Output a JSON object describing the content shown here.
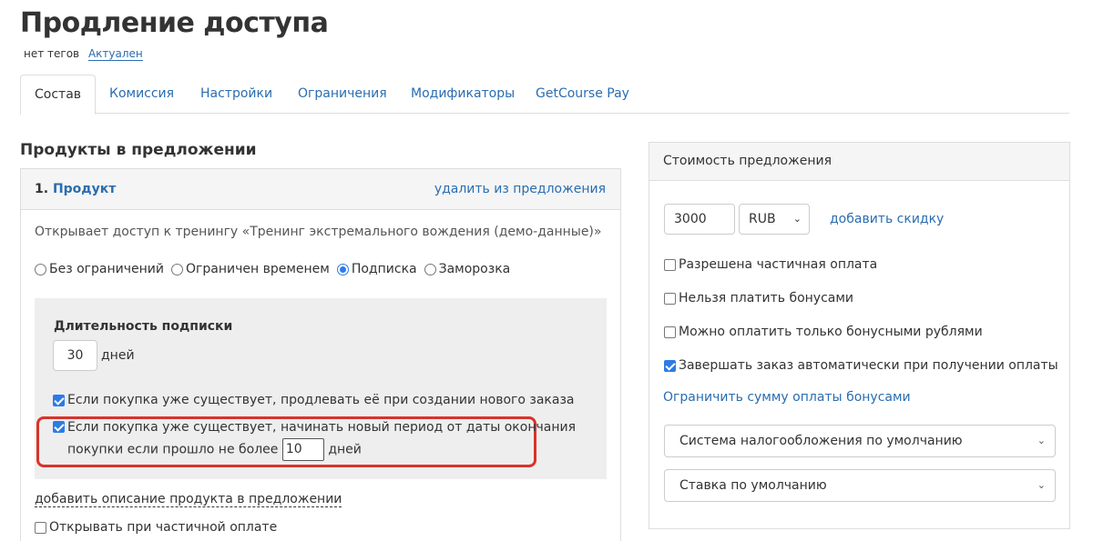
{
  "page": {
    "title": "Продление доступа",
    "tags_label": "нет тегов",
    "status_link": "Актуален"
  },
  "tabs": [
    {
      "label": "Состав",
      "active": true
    },
    {
      "label": "Комиссия"
    },
    {
      "label": "Настройки"
    },
    {
      "label": "Ограничения"
    },
    {
      "label": "Модификаторы"
    },
    {
      "label": "GetCourse Pay"
    }
  ],
  "products": {
    "heading": "Продукты в предложении",
    "item": {
      "number": "1.",
      "name": "Продукт",
      "remove_link": "удалить из предложения",
      "description": "Открывает доступ к тренингу «Тренинг экстремального вождения (демо-данные)»",
      "access_options": [
        {
          "label": "Без ограничений",
          "checked": false
        },
        {
          "label": "Ограничен временем",
          "checked": false
        },
        {
          "label": "Подписка",
          "checked": true
        },
        {
          "label": "Заморозка",
          "checked": false
        }
      ],
      "subscription": {
        "title": "Длительность подписки",
        "duration_value": "30",
        "duration_unit": "дней",
        "extend_label": "Если покупка уже существует, продлевать её при создании нового заказа",
        "extend_checked": true,
        "new_period_line1": "Если покупка уже существует, начинать новый период от даты окончания",
        "new_period_line2": "покупки если прошло не более",
        "new_period_days": "10",
        "new_period_unit": "дней",
        "new_period_checked": true
      },
      "add_description_link": "добавить описание продукта в предложении",
      "partial_open_label": "Открывать при частичной оплате",
      "partial_open_checked": false
    }
  },
  "pricing": {
    "heading": "Стоимость предложения",
    "price_value": "3000",
    "currency": "RUB",
    "add_discount_link": "добавить скидку",
    "options": [
      {
        "label": "Разрешена частичная оплата",
        "checked": false
      },
      {
        "label": "Нельзя платить бонусами",
        "checked": false
      },
      {
        "label": "Можно оплатить только бонусными рублями",
        "checked": false
      },
      {
        "label": "Завершать заказ автоматически при получении оплаты",
        "checked": true
      }
    ],
    "limit_bonus_link": "Ограничить сумму оплаты бонусами",
    "tax_system": "Система налогообложения по умолчанию",
    "tax_rate": "Ставка по умолчанию"
  },
  "colors": {
    "link": "#2a6db0",
    "checked": "#2d7be5",
    "highlight": "#d9322b"
  }
}
